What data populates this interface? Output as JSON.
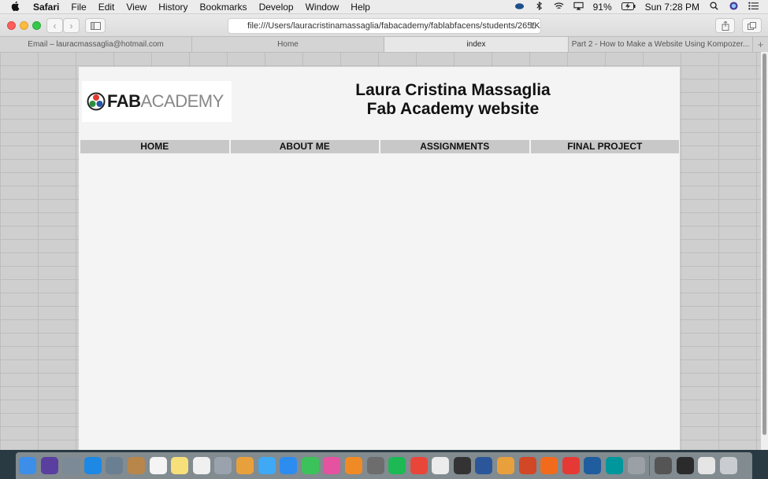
{
  "menubar": {
    "app": "Safari",
    "items": [
      "File",
      "Edit",
      "View",
      "History",
      "Bookmarks",
      "Develop",
      "Window",
      "Help"
    ],
    "battery": "91%",
    "clock": "Sun 7:28 PM"
  },
  "toolbar": {
    "url": "file:///Users/lauracristinamassaglia/fabacademy/fablabfacens/students/265/Kom"
  },
  "tabs": [
    {
      "label": "Email – lauracmassaglia@hotmail.com",
      "active": false
    },
    {
      "label": "Home",
      "active": false
    },
    {
      "label": "index",
      "active": true
    },
    {
      "label": "Part 2 - How to Make a Website Using Kompozer...",
      "active": false
    }
  ],
  "page": {
    "logo": {
      "fab": "FAB",
      "academy": "ACADEMY"
    },
    "title_line1": "Laura Cristina Massaglia",
    "title_line2": "Fab Academy website",
    "nav": [
      "HOME",
      "ABOUT ME",
      "ASSIGNMENTS",
      "FINAL PROJECT"
    ]
  },
  "dock": {
    "icons": [
      {
        "name": "finder-icon",
        "color": "#3d8ee8"
      },
      {
        "name": "siri-icon",
        "color": "#5a3fa0"
      },
      {
        "name": "launchpad-icon",
        "color": "#7b8a96"
      },
      {
        "name": "safari-icon",
        "color": "#1e88e5"
      },
      {
        "name": "preview-icon",
        "color": "#6b7f92"
      },
      {
        "name": "contacts-icon",
        "color": "#b8864a"
      },
      {
        "name": "calendar-icon",
        "color": "#f4f4f4"
      },
      {
        "name": "notes-icon",
        "color": "#f7e07a"
      },
      {
        "name": "reminders-icon",
        "color": "#f0f0f0"
      },
      {
        "name": "photo-viewer-icon",
        "color": "#9aa3ad"
      },
      {
        "name": "photos-icon",
        "color": "#e8a03c"
      },
      {
        "name": "messages-icon",
        "color": "#3fa9f5"
      },
      {
        "name": "app-store-icon",
        "color": "#2d8cf0"
      },
      {
        "name": "facetime-icon",
        "color": "#3cc25a"
      },
      {
        "name": "itunes-icon",
        "color": "#e552a0"
      },
      {
        "name": "ibooks-icon",
        "color": "#f08a24"
      },
      {
        "name": "system-preferences-icon",
        "color": "#6d6d6d"
      },
      {
        "name": "spotify-icon",
        "color": "#1db954"
      },
      {
        "name": "chrome-icon",
        "color": "#e9463a"
      },
      {
        "name": "textedit-icon",
        "color": "#ececec"
      },
      {
        "name": "inkscape-icon",
        "color": "#333333"
      },
      {
        "name": "word-icon",
        "color": "#2b579a"
      },
      {
        "name": "fab-app-icon",
        "color": "#e8a03c"
      },
      {
        "name": "powerpoint-icon",
        "color": "#d24726"
      },
      {
        "name": "firefox-icon",
        "color": "#f26b1d"
      },
      {
        "name": "brasero-icon",
        "color": "#e53935"
      },
      {
        "name": "quicktime-icon",
        "color": "#1f5d9e"
      },
      {
        "name": "arduino-icon",
        "color": "#00979c"
      },
      {
        "name": "scanner-icon",
        "color": "#9aa0a6"
      },
      {
        "name": "document-icon",
        "color": "#555555"
      },
      {
        "name": "terminal-icon",
        "color": "#2b2b2b"
      },
      {
        "name": "files-icon",
        "color": "#e5e5e5"
      },
      {
        "name": "trash-icon",
        "color": "#c9ccd0"
      }
    ]
  }
}
